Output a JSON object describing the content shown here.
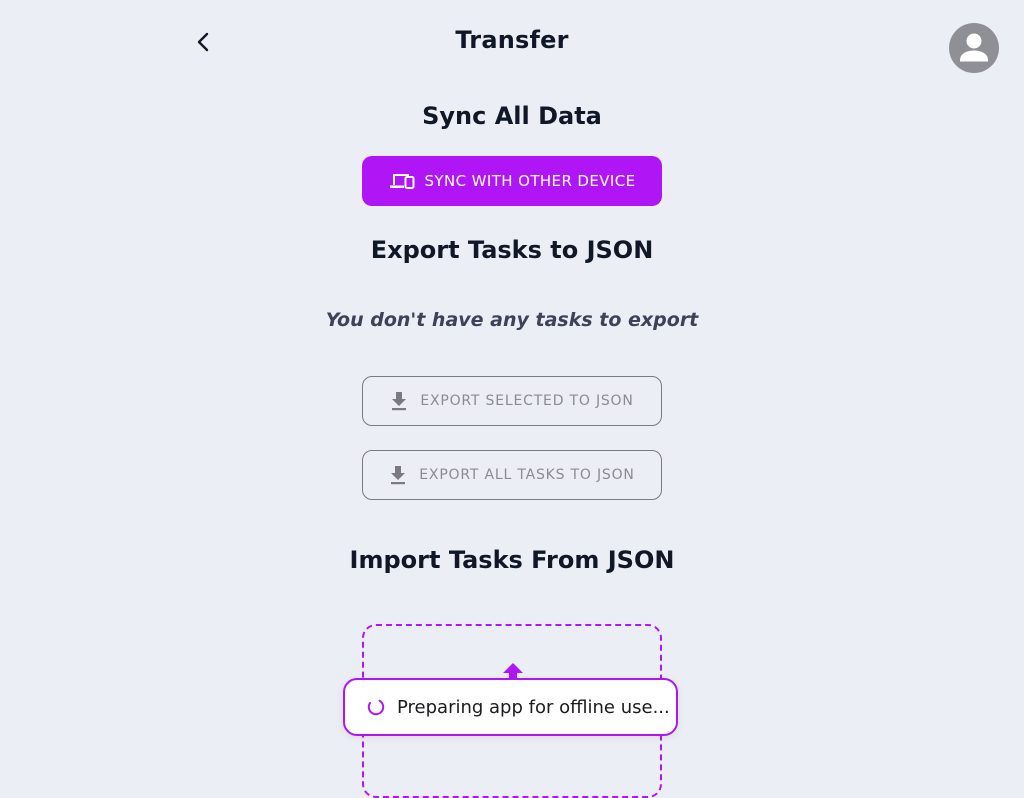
{
  "header": {
    "title": "Transfer",
    "back_icon": "chevron-left-icon",
    "avatar_icon": "person-icon"
  },
  "sync": {
    "heading": "Sync All Data",
    "button_label": "SYNC WITH OTHER DEVICE",
    "button_icon": "devices-icon",
    "accent_color": "#b016f5"
  },
  "export": {
    "heading": "Export Tasks to JSON",
    "empty_message": "You don't have any tasks to export",
    "selected_label": "EXPORT SELECTED TO JSON",
    "all_label": "EXPORT ALL TASKS TO JSON",
    "button_icon": "download-icon"
  },
  "import": {
    "heading": "Import Tasks From JSON",
    "upload_icon": "upload-icon"
  },
  "toast": {
    "message": "Preparing app for offline use...",
    "icon": "spinner-icon"
  }
}
